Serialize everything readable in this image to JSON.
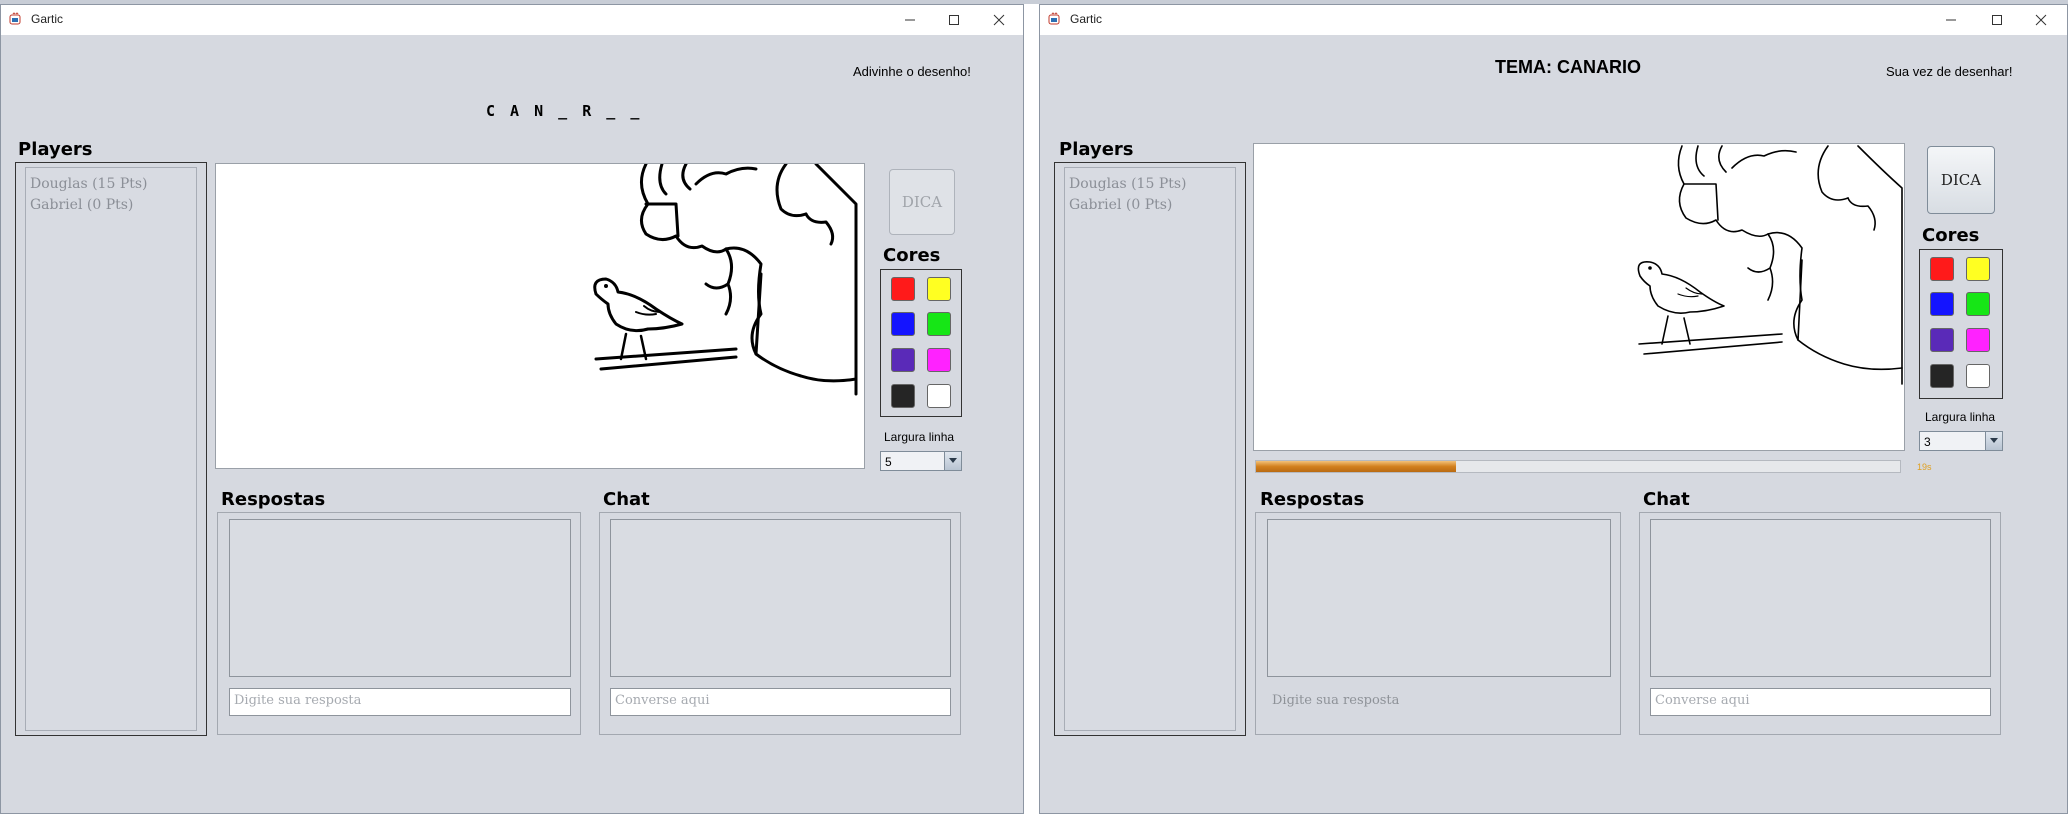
{
  "left_window": {
    "title": "Gartic",
    "status": "Adivinhe o desenho!",
    "hint": "C A N _ R _ _",
    "players_title": "Players",
    "players": [
      "Douglas (15 Pts)",
      "Gabriel (0 Pts)"
    ],
    "dica_label": "DICA",
    "cores_title": "Cores",
    "colors": [
      "#ff1a1a",
      "#ffff22",
      "#1414ff",
      "#16e616",
      "#5a2ab8",
      "#ff22ff",
      "#252525",
      "#ffffff"
    ],
    "largura_label": "Largura linha",
    "largura_value": "5",
    "respostas_title": "Respostas",
    "respostas_placeholder": "Digite sua resposta",
    "chat_title": "Chat",
    "chat_placeholder": "Converse aqui"
  },
  "right_window": {
    "title": "Gartic",
    "tema": "TEMA: CANARIO",
    "status": "Sua vez de desenhar!",
    "players_title": "Players",
    "players": [
      "Douglas (15 Pts)",
      "Gabriel (0 Pts)"
    ],
    "dica_label": "DICA",
    "cores_title": "Cores",
    "colors": [
      "#ff1a1a",
      "#ffff22",
      "#1414ff",
      "#16e616",
      "#5a2ab8",
      "#ff22ff",
      "#252525",
      "#ffffff"
    ],
    "largura_label": "Largura linha",
    "largura_value": "3",
    "progress_fraction": 0.31,
    "timer": "19s",
    "respostas_title": "Respostas",
    "respostas_placeholder": "Digite sua resposta",
    "chat_title": "Chat",
    "chat_placeholder": "Converse aqui"
  }
}
